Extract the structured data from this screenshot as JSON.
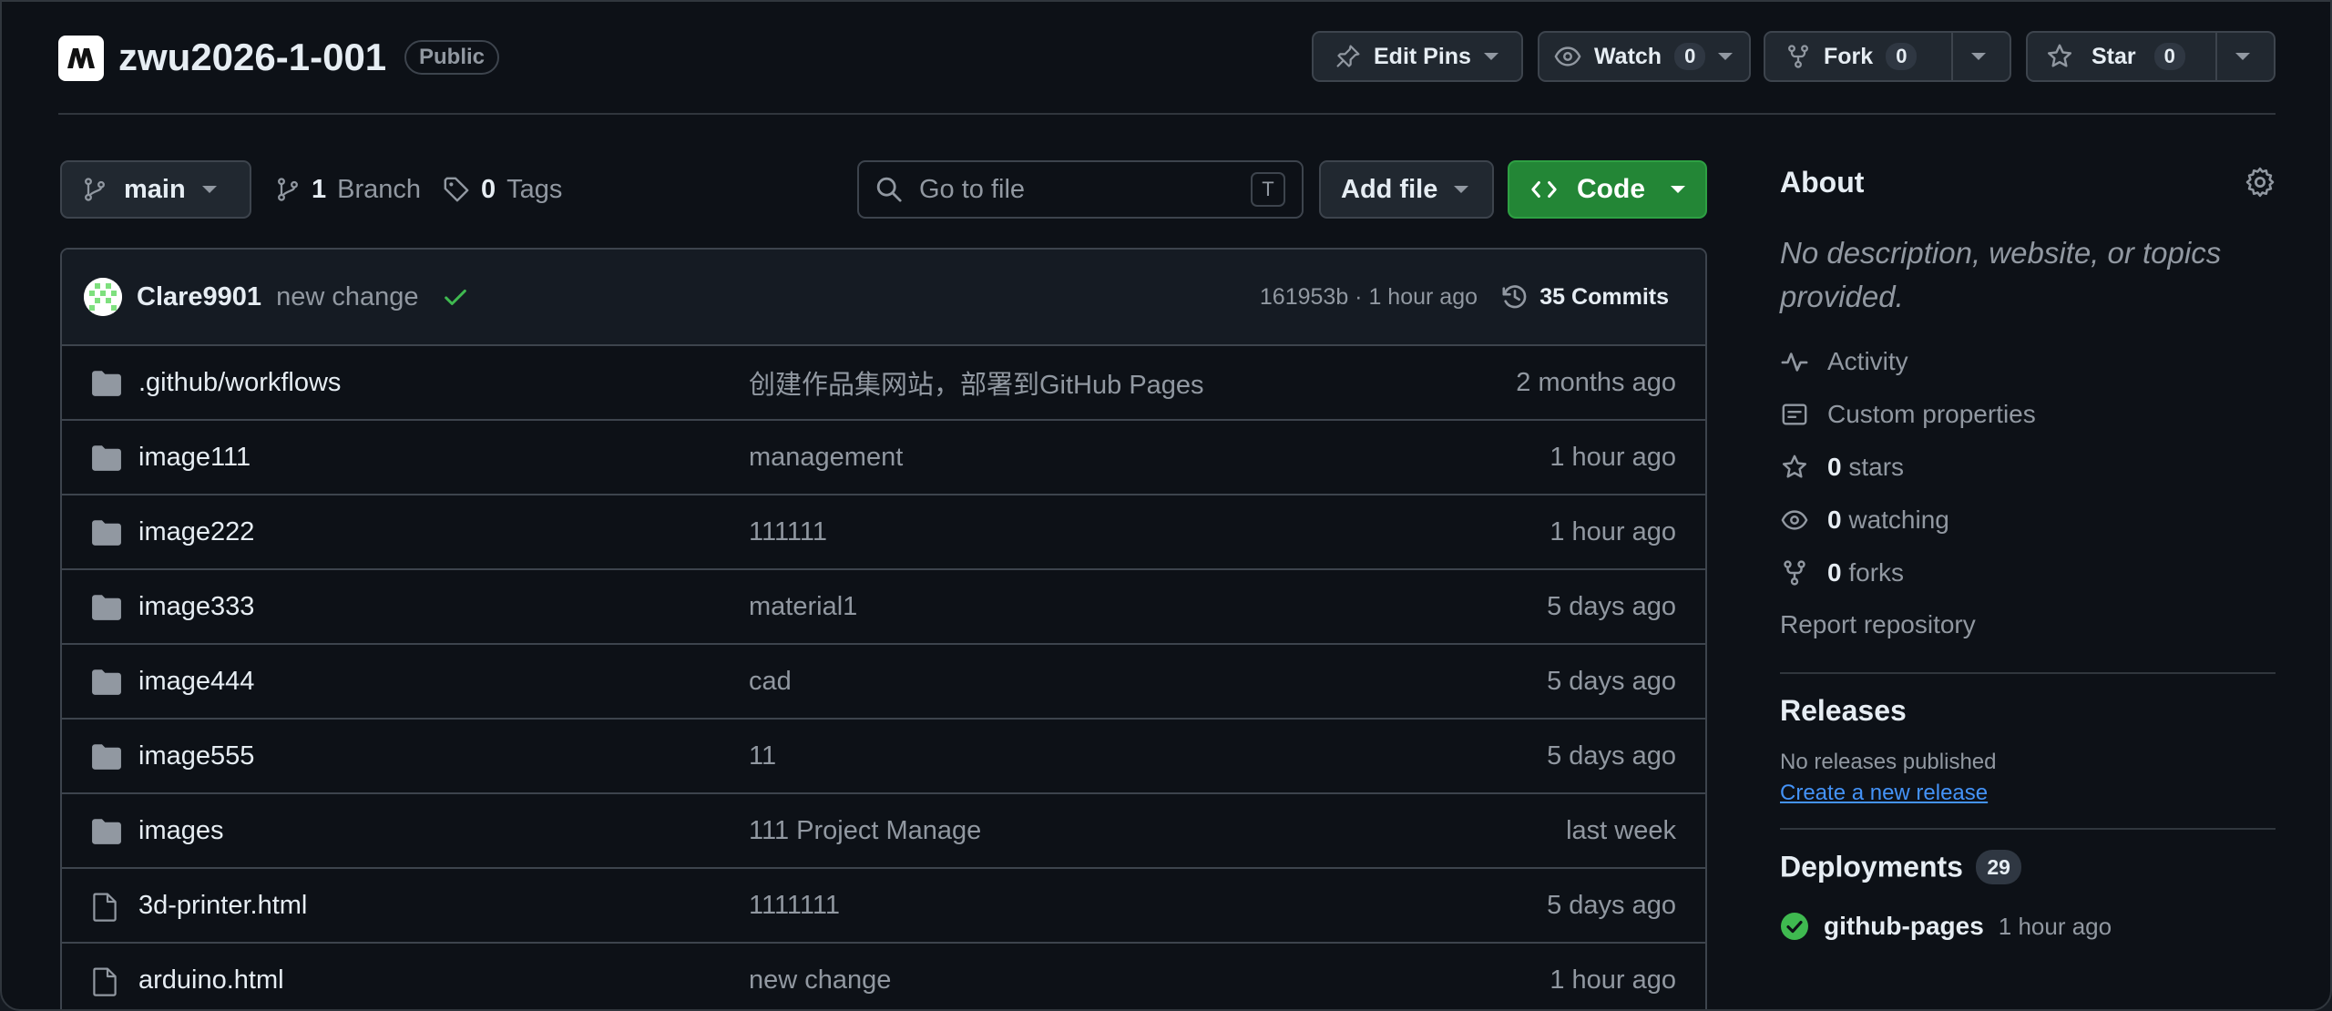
{
  "repo": {
    "name": "zwu2026-1-001",
    "visibility": "Public"
  },
  "header_actions": {
    "edit_pins": "Edit Pins",
    "watch": "Watch",
    "watch_count": "0",
    "fork": "Fork",
    "fork_count": "0",
    "star": "Star",
    "star_count": "0"
  },
  "toolbar": {
    "branch": "main",
    "branch_count": "1",
    "branch_label": "Branch",
    "tag_count": "0",
    "tag_label": "Tags",
    "search_placeholder": "Go to file",
    "search_shortcut": "T",
    "add_file": "Add file",
    "code": "Code"
  },
  "latest_commit": {
    "author": "Clare9901",
    "message": "new change",
    "sha": "161953b",
    "separator": "·",
    "time": "1 hour ago",
    "commits_label": "35 Commits"
  },
  "files": [
    {
      "type": "folder",
      "name": ".github/workflows",
      "message": "创建作品集网站，部署到GitHub Pages",
      "time": "2 months ago"
    },
    {
      "type": "folder",
      "name": "image111",
      "message": "management",
      "time": "1 hour ago"
    },
    {
      "type": "folder",
      "name": "image222",
      "message": "111111",
      "time": "1 hour ago"
    },
    {
      "type": "folder",
      "name": "image333",
      "message": "material1",
      "time": "5 days ago"
    },
    {
      "type": "folder",
      "name": "image444",
      "message": "cad",
      "time": "5 days ago"
    },
    {
      "type": "folder",
      "name": "image555",
      "message": "11",
      "time": "5 days ago"
    },
    {
      "type": "folder",
      "name": "images",
      "message": "111 Project Manage",
      "time": "last week"
    },
    {
      "type": "file",
      "name": "3d-printer.html",
      "message": "1111111",
      "time": "5 days ago"
    },
    {
      "type": "file",
      "name": "arduino.html",
      "message": "new change",
      "time": "1 hour ago"
    }
  ],
  "about": {
    "title": "About",
    "description": "No description, website, or topics provided.",
    "activity": "Activity",
    "custom_properties": "Custom properties",
    "stars_count": "0",
    "stars_label": "stars",
    "watching_count": "0",
    "watching_label": "watching",
    "forks_count": "0",
    "forks_label": "forks",
    "report": "Report repository"
  },
  "releases": {
    "title": "Releases",
    "none": "No releases published",
    "create": "Create a new release"
  },
  "deployments": {
    "title": "Deployments",
    "count": "29",
    "latest_name": "github-pages",
    "latest_time": "1 hour ago"
  },
  "colors": {
    "background": "#0d1117",
    "border": "#3d444d",
    "primary_button": "#238636",
    "link": "#4493f8",
    "success": "#3fb950"
  }
}
